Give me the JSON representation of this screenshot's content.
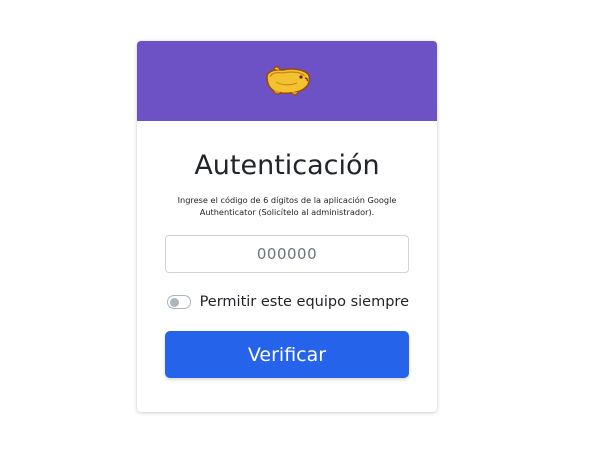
{
  "header": {
    "logo_icon": "bread-bear-logo-icon",
    "background_color": "#6c52c4"
  },
  "auth": {
    "title": "Autenticación",
    "description": "Ingrese el código de 6 dígitos de la aplicación Google Authenticator (Solicítelo al administrador).",
    "code_input": {
      "value": "",
      "placeholder": "000000"
    },
    "remember_device": {
      "label": "Permitir este equipo siempre",
      "checked": false
    },
    "verify_button": {
      "label": "Verificar",
      "color": "#2563eb"
    }
  }
}
